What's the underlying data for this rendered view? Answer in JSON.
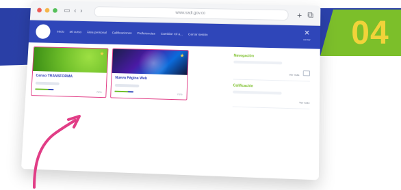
{
  "step_badge": {
    "number": "04"
  },
  "browser": {
    "url": "www.sadi.gov.co",
    "toolbar": {
      "nav_back": "‹",
      "nav_forward": "›",
      "new_tab": "+",
      "copy": "⧉"
    }
  },
  "app": {
    "nav": [
      "Inicio",
      "Mi curso",
      "Área personal",
      "Calificaciones",
      "Preferencias",
      "Cambiar rol a...",
      "Cerrar sesión"
    ],
    "close_label": "cerrar"
  },
  "courses": [
    {
      "title": "Censo TRANSFORMA",
      "progress_percent": 70,
      "percent_text": "70%"
    },
    {
      "title": "Nueva Página Web",
      "progress_percent": 70,
      "percent_text": "70%"
    }
  ],
  "sidebar": {
    "block1_title": "Navegación",
    "block1_link": "Ver más",
    "block2_title": "Calificación",
    "block2_link": "Ver todo"
  },
  "colors": {
    "brand_blue": "#2f46b9",
    "accent_green": "#7cbf2a",
    "accent_pink": "#e13d86",
    "badge_yellow": "#f1d33a"
  },
  "icons": {
    "arrow": "hand-drawn-arrow-icon",
    "star": "star-icon",
    "close": "close-icon"
  }
}
